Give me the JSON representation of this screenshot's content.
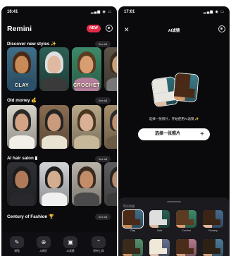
{
  "top_fragment": "",
  "left_screen": {
    "status_time": "16:41",
    "app_title": "Remini",
    "pro_badge": "NEW",
    "sections": [
      {
        "title": "Discover new styles",
        "see_all": "See All",
        "cards": [
          {
            "label": "CLAY",
            "skin": "#c88a57",
            "bg": "#3f6f8a",
            "hair": "#4a2a17",
            "shirt": "#2c4f6b"
          },
          {
            "label": "",
            "skin": "#e0b9a0",
            "bg": "#2d5e54",
            "hair": "#dedede",
            "shirt": "#3a3a3a"
          },
          {
            "label": "CROCHET",
            "skin": "#d99d72",
            "bg": "#3d8a6a",
            "hair": "#5b3b22",
            "shirt": "#b57f9c"
          },
          {
            "label": "",
            "skin": "#c9a07a",
            "bg": "#5b5448",
            "hair": "#3a2c20",
            "shirt": "#777"
          }
        ]
      },
      {
        "title": "Old money",
        "see_all": "See All",
        "cards": [
          {
            "skin": "#d4a383",
            "bg": "#d9d4ca",
            "hair": "#2a2a2a",
            "shirt": "#f2efe8"
          },
          {
            "skin": "#c99a7b",
            "bg": "#8a6d52",
            "hair": "#232323",
            "shirt": "#e8e2d2"
          },
          {
            "skin": "#d9b096",
            "bg": "#b8a88a",
            "hair": "#4a3520",
            "shirt": "#c7b899"
          },
          {
            "skin": "#c48f6d",
            "bg": "#a48d6b",
            "hair": "#2b2b2b",
            "shirt": "#6b5a44"
          }
        ]
      },
      {
        "title": "AI hair salon",
        "see_all": "See All",
        "cards": [
          {
            "skin": "#b07a5a",
            "bg": "#2f3035",
            "hair": "#1c1c1c",
            "shirt": "#28282c"
          },
          {
            "skin": "#d4ad91",
            "bg": "#d2d4d8",
            "hair": "#202020",
            "shirt": "#f0f0f0"
          },
          {
            "skin": "#c48d6a",
            "bg": "#b9b3a9",
            "hair": "#3a2a20",
            "shirt": "#4a4a4a"
          },
          {
            "skin": "#b98c70",
            "bg": "#5d5d5f",
            "hair": "#252525",
            "shirt": "#3b3b3b"
          }
        ]
      },
      {
        "title": "Century of Fashion",
        "see_all": "See All"
      }
    ],
    "nav": [
      {
        "icon": "✎",
        "label": "增强"
      },
      {
        "icon": "⊕",
        "label": "AI照片"
      },
      {
        "icon": "▣",
        "label": "AI滤镜"
      },
      {
        "icon": "⌃",
        "label": "所有工具"
      }
    ]
  },
  "right_screen": {
    "status_time": "17:01",
    "title": "AI滤镜",
    "hint": "选择一张照片，开始使用AI滤镜 ✨",
    "select_button": "选择一张照片",
    "sheet_label": "不同风格",
    "styles": [
      {
        "name": "Clay",
        "skin": "#c88a57",
        "bg": "#3f6f8a",
        "hair": "#4a2a17"
      },
      {
        "name": "Jade",
        "skin": "#e0b9a0",
        "bg": "#2d5e54",
        "hair": "#dedede"
      },
      {
        "name": "Crochet",
        "skin": "#d99d72",
        "bg": "#3d8a6a",
        "hair": "#5b3b22"
      },
      {
        "name": "Flowery",
        "skin": "#e4b89a",
        "bg": "#476c8f",
        "hair": "#3a2415"
      },
      {
        "skin": "#c89266",
        "bg": "#57906e",
        "hair": "#3a2a1a"
      },
      {
        "skin": "#e3c4ae",
        "bg": "#68708e",
        "hair": "#f0e9da"
      },
      {
        "skin": "#d3a07a",
        "bg": "#b27a8c",
        "hair": "#4a2c1b"
      },
      {
        "skin": "#cfa07e",
        "bg": "#4d7b9a",
        "hair": "#2d2015"
      }
    ],
    "hero_left": {
      "skin": "#e2bea4",
      "bg": "#2f6e78",
      "hair": "#e8e6e0"
    },
    "hero_right": {
      "skin": "#d89a6c",
      "bg": "#3f7d8c",
      "hair": "#4a2a16"
    }
  }
}
